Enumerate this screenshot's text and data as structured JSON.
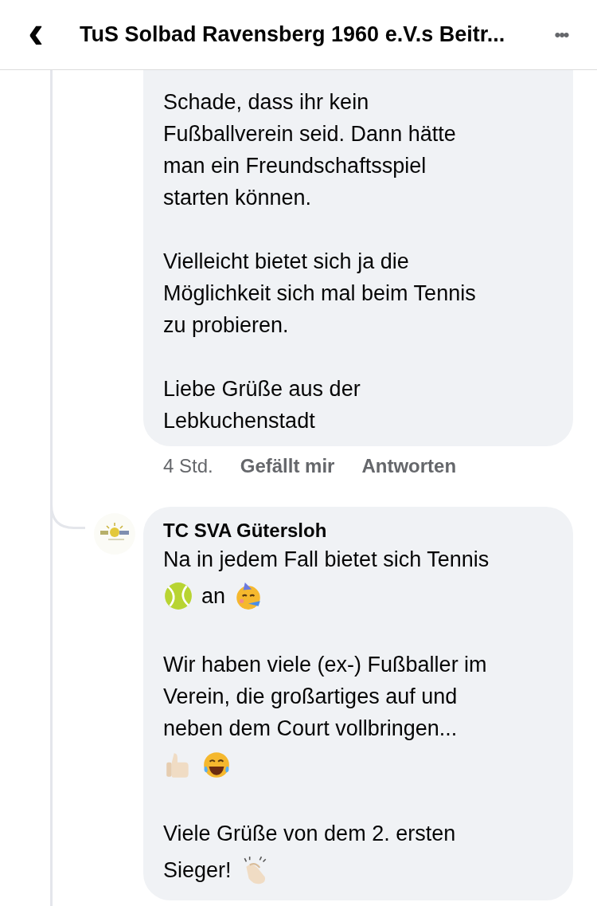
{
  "header": {
    "back": "‹",
    "title": "TuS Solbad Ravensberg 1960 e.V.s Beitr...",
    "more": "•••"
  },
  "comments": [
    {
      "paragraphs": [
        [
          [
            {
              "kind": "text",
              "text": "Schade, dass ihr kein"
            }
          ],
          [
            {
              "kind": "text",
              "text": "Fußballverein seid. Dann hätte"
            }
          ],
          [
            {
              "kind": "text",
              "text": "man ein Freundschaftsspiel"
            }
          ],
          [
            {
              "kind": "text",
              "text": "starten können."
            }
          ]
        ],
        [
          [
            {
              "kind": "text",
              "text": "Vielleicht bietet sich ja die"
            }
          ],
          [
            {
              "kind": "text",
              "text": "Möglichkeit sich mal beim Tennis"
            }
          ],
          [
            {
              "kind": "text",
              "text": "zu probieren."
            }
          ]
        ],
        [
          [
            {
              "kind": "text",
              "text": "Liebe Grüße aus der"
            }
          ],
          [
            {
              "kind": "text",
              "text": "Lebkuchenstadt"
            }
          ]
        ]
      ],
      "time": "4 Std.",
      "actions": [
        "Gefällt mir",
        "Antworten"
      ]
    },
    {
      "author": "TC SVA Gütersloh",
      "avatar": {
        "kind": "picture"
      },
      "paragraphs": [
        [
          [
            {
              "kind": "text",
              "text": "Na in jedem Fall bietet sich Tennis"
            }
          ],
          [
            {
              "kind": "tennis_ball"
            },
            {
              "kind": "text",
              "text": "an"
            },
            {
              "kind": "party_face"
            }
          ]
        ],
        [
          [
            {
              "kind": "text",
              "text": "Wir haben viele (ex-) Fußballer im"
            }
          ],
          [
            {
              "kind": "text",
              "text": "Verein, die großartiges auf und"
            }
          ],
          [
            {
              "kind": "text",
              "text": "neben dem Court vollbringen..."
            }
          ],
          [
            {
              "kind": "thumbs_up"
            },
            {
              "kind": "laughing_face"
            }
          ]
        ],
        [
          [
            {
              "kind": "text",
              "text": "Viele Grüße von dem 2. ersten"
            }
          ],
          [
            {
              "kind": "text",
              "text": "Sieger!"
            },
            {
              "kind": "clapping_hands"
            }
          ]
        ]
      ]
    }
  ]
}
